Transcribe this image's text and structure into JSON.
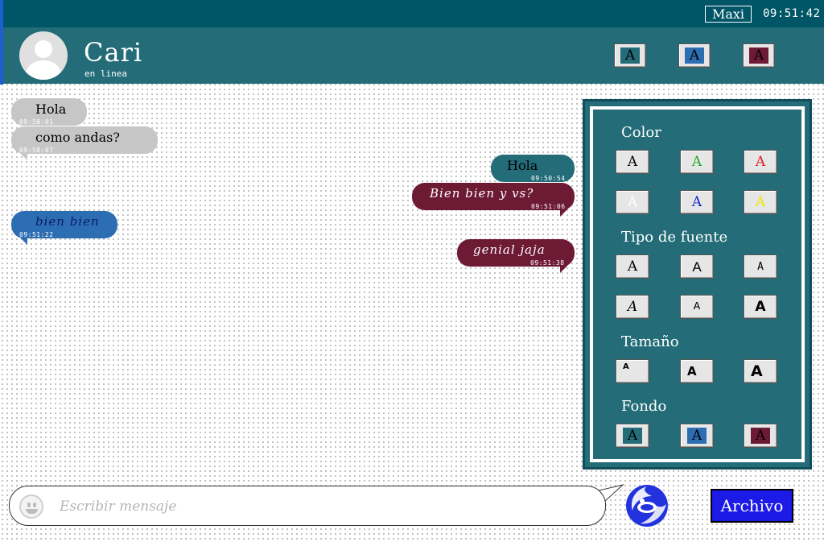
{
  "topbar": {
    "user": "Maxi",
    "time": "09:51:42"
  },
  "header": {
    "contact_name": "Cari",
    "status": "en linea",
    "theme_buttons": [
      {
        "glyph": "A",
        "bg": "#236c78"
      },
      {
        "glyph": "A",
        "bg": "#2d6eb3"
      },
      {
        "glyph": "A",
        "bg": "#6d1a35"
      }
    ]
  },
  "messages": [
    {
      "text": "Hola",
      "time": "09:50:01",
      "direction": "in",
      "color": "gray"
    },
    {
      "text": "como andas?",
      "time": "09:50:07",
      "direction": "in",
      "color": "gray"
    },
    {
      "text": "Hola",
      "time": "09:50:54",
      "direction": "out",
      "color": "teal"
    },
    {
      "text": "Bien bien y vs?",
      "time": "09:51:06",
      "direction": "out",
      "color": "wine"
    },
    {
      "text": "bien bien",
      "time": "09:51:22",
      "direction": "in",
      "color": "blue"
    },
    {
      "text": "genial jaja",
      "time": "09:51:38",
      "direction": "out",
      "color": "wine"
    }
  ],
  "panel": {
    "color_title": "Color",
    "font_title": "Tipo de fuente",
    "size_title": "Tamaño",
    "bg_title": "Fondo",
    "colors": [
      "#000000",
      "#22aa22",
      "#dd2222",
      "#ffffff",
      "#1a22cc",
      "#e8e800"
    ],
    "glyph": "A"
  },
  "composer": {
    "placeholder": "Escribir mensaje"
  },
  "file_button": "Archivo"
}
